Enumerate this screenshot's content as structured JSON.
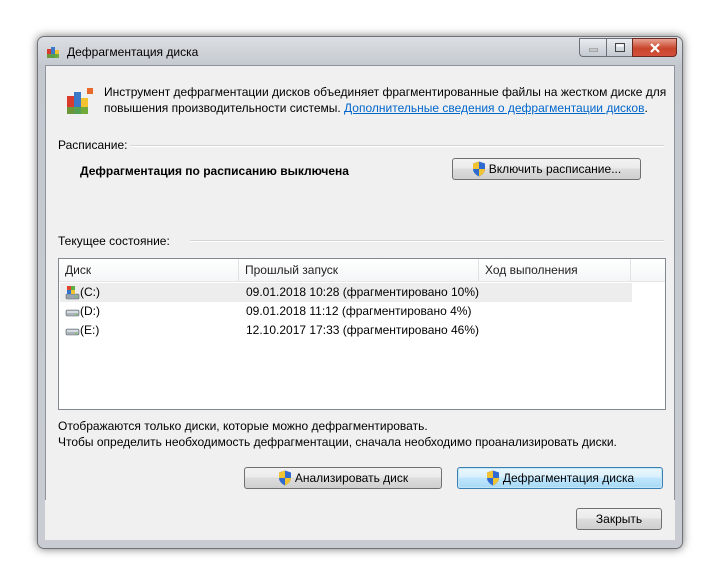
{
  "window": {
    "title": "Дефрагментация диска",
    "accent": "#3c7fb1"
  },
  "intro": {
    "text": "Инструмент дефрагментации дисков объединяет фрагментированные файлы на жестком диске для повышения производительности системы. ",
    "link": "Дополнительные сведения о дефрагментации дисков",
    "tail": "."
  },
  "schedule": {
    "label": "Расписание:",
    "status": "Дефрагментация по расписанию выключена",
    "button": "Включить расписание..."
  },
  "current": {
    "label": "Текущее состояние:",
    "columns": [
      "Диск",
      "Прошлый запуск",
      "Ход выполнения"
    ],
    "rows": [
      {
        "disk": "(C:)",
        "last": "09.01.2018 10:28 (фрагментировано 10%)",
        "progress": "",
        "icon": "system-drive-icon"
      },
      {
        "disk": "(D:)",
        "last": "09.01.2018 11:12 (фрагментировано 4%)",
        "progress": "",
        "icon": "drive-icon"
      },
      {
        "disk": "(E:)",
        "last": "12.10.2017 17:33 (фрагментировано 46%)",
        "progress": "",
        "icon": "drive-icon"
      }
    ]
  },
  "info": {
    "line1": "Отображаются только диски, которые можно дефрагментировать.",
    "line2": "Чтобы определить необходимость  дефрагментации, сначала необходимо проанализировать диски."
  },
  "actions": {
    "analyze": "Анализировать диск",
    "defrag": "Дефрагментация диска",
    "close": "Закрыть"
  }
}
